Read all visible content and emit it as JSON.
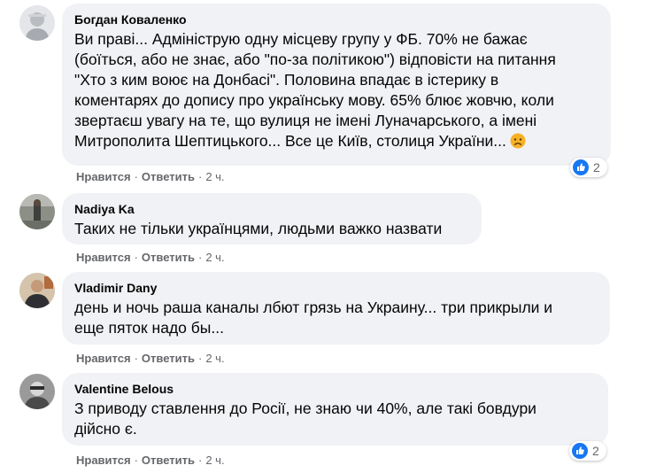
{
  "comments": [
    {
      "author": "Богдан Коваленко",
      "text_lines": [
        "Ви праві... Адмініструю одну місцеву групу у ФБ. 70% не бажає",
        "(боїться, або не знає, або \"по-за політикою\") відповісти на питання",
        "\"Хто з ким воює на Донбасі\". Половина впадає в істерику в",
        "коментарях до допису про українську мову. 65% блює жовчю, коли",
        "звертаєш увагу на те, що вулиця не імені Луначарського, а імені",
        "Митрополита Шептицького... Все це Київ, столиця України..."
      ],
      "emoji": "sad-face-emoji",
      "like_label": "Нравится",
      "reply_label": "Ответить",
      "time": "2 ч.",
      "reaction_count": "2"
    },
    {
      "author": "Nadiya Ka",
      "text_lines": [
        "Таких не тільки українцями, людьми важко назвати"
      ],
      "like_label": "Нравится",
      "reply_label": "Ответить",
      "time": "2 ч."
    },
    {
      "author": "Vladimir Dany",
      "text_lines": [
        "день и ночь раша каналы лбют грязь на Украину... три прикрыли и",
        "еще пяток надо бы..."
      ],
      "like_label": "Нравится",
      "reply_label": "Ответить",
      "time": "2 ч."
    },
    {
      "author": "Valentine Belous",
      "text_lines": [
        "З приводу ставлення до Росії, не знаю чи 40%, але такі бовдури",
        "дійсно є."
      ],
      "like_label": "Нравится",
      "reply_label": "Ответить",
      "time": "2 ч.",
      "reaction_count": "2"
    }
  ],
  "separator": "·",
  "colors": {
    "bubble": "#f0f2f5",
    "meta_text": "#65676b",
    "like_blue": "#1877f2"
  }
}
